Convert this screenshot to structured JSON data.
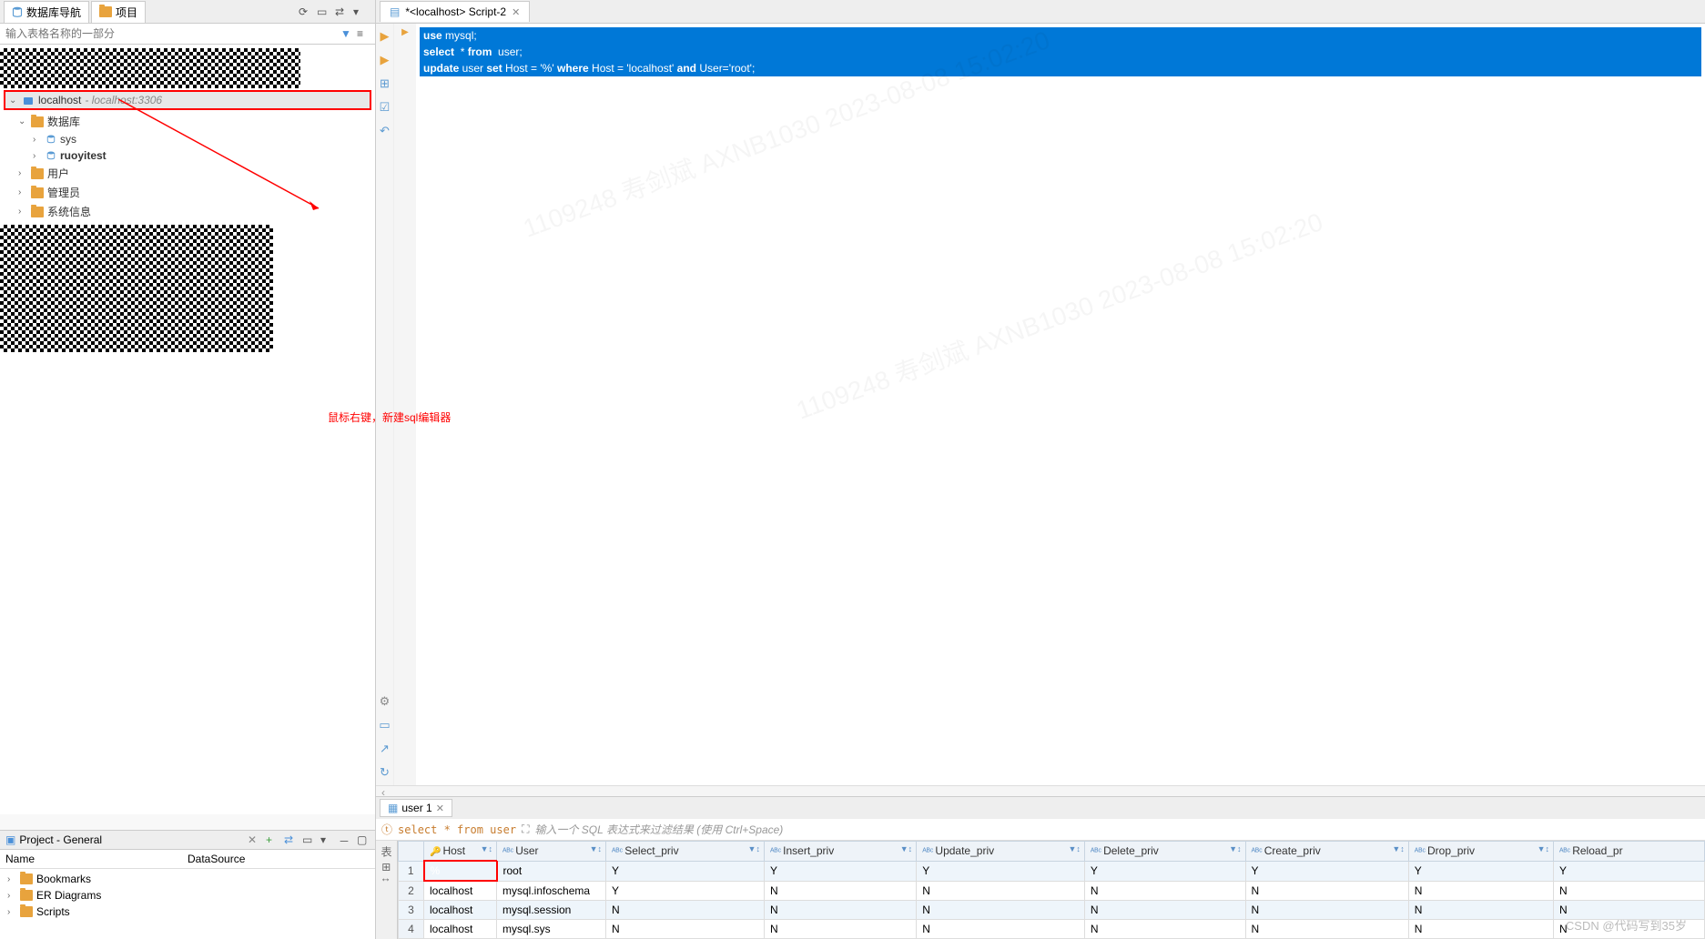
{
  "nav": {
    "tab1": "数据库导航",
    "tab2": "项目",
    "filter_placeholder": "输入表格名称的一部分"
  },
  "tree": {
    "connection": "localhost",
    "connection_info": "- localhost:3306",
    "databases_label": "数据库",
    "db_sys": "sys",
    "db_ruoyitest": "ruoyitest",
    "users_label": "用户",
    "admin_label": "管理员",
    "sysinfo_label": "系统信息"
  },
  "annotation": {
    "hint": "鼠标右键，新建sql编辑器"
  },
  "project": {
    "title": "Project - General",
    "col_name": "Name",
    "col_datasource": "DataSource",
    "item_bookmarks": "Bookmarks",
    "item_er": "ER Diagrams",
    "item_scripts": "Scripts"
  },
  "editor": {
    "tab_label": "*<localhost> Script-2",
    "line1_kw1": "use",
    "line1_rest": " mysql;",
    "line2_kw1": "select",
    "line2_mid": "  * ",
    "line2_kw2": "from",
    "line2_rest": "  user;",
    "line3_kw1": "update",
    "line3_p1": " user ",
    "line3_kw2": "set",
    "line3_p2": " Host = ",
    "line3_s1": "'%'",
    "line3_p3": " ",
    "line3_kw3": "where",
    "line3_p4": " Host = ",
    "line3_s2": "'localhost'",
    "line3_p5": " ",
    "line3_kw4": "and",
    "line3_p6": " User=",
    "line3_s3": "'root'",
    "line3_end": ";"
  },
  "results": {
    "tab_label": "user 1",
    "sql": "select * from user",
    "filter_hint": "输入一个 SQL 表达式来过滤结果 (使用 Ctrl+Space)",
    "columns": [
      "Host",
      "User",
      "Select_priv",
      "Insert_priv",
      "Update_priv",
      "Delete_priv",
      "Create_priv",
      "Drop_priv",
      "Reload_pr"
    ],
    "rows": [
      {
        "n": "1",
        "cells": [
          "%",
          "root",
          "Y",
          "Y",
          "Y",
          "Y",
          "Y",
          "Y",
          "Y"
        ]
      },
      {
        "n": "2",
        "cells": [
          "localhost",
          "mysql.infoschema",
          "Y",
          "N",
          "N",
          "N",
          "N",
          "N",
          "N"
        ]
      },
      {
        "n": "3",
        "cells": [
          "localhost",
          "mysql.session",
          "N",
          "N",
          "N",
          "N",
          "N",
          "N",
          "N"
        ]
      },
      {
        "n": "4",
        "cells": [
          "localhost",
          "mysql.sys",
          "N",
          "N",
          "N",
          "N",
          "N",
          "N",
          "N"
        ]
      }
    ]
  },
  "watermark": {
    "text1": "1109248 寿剑斌 AXNB1030 2023-08-08 15:02:20",
    "credit": "CSDN @代码写到35岁"
  }
}
